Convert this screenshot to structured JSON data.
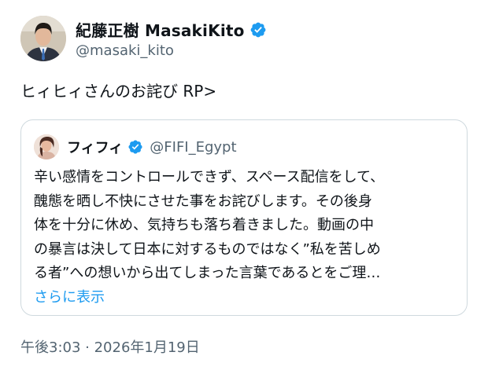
{
  "author": {
    "display_name": "紀藤正樹 MasakiKito",
    "handle": "@masaki_kito",
    "avatar_icon": "person-portrait-icon",
    "verified_icon": "verified-badge-icon"
  },
  "tweet": {
    "text": "ヒィヒィさんのお詫び RP>"
  },
  "quoted_tweet": {
    "display_name": "フィフィ",
    "handle": "@FIFI_Egypt",
    "avatar_icon": "person-portrait-icon",
    "verified_icon": "verified-badge-icon",
    "lines": [
      "辛い感情をコントロールできず、スペース配信をして、",
      "醜態を晒し不快にさせた事をお詫びします。その後身",
      "体を十分に休め、気持ちも落ち着きました。動画の中",
      "の暴言は決して日本に対するものではなく”私を苦しめ",
      "る者”への想いから出てしまった言葉であるとをご理…"
    ],
    "show_more_label": "さらに表示"
  },
  "timestamp": "午後3:03 · 2026年1月19日",
  "colors": {
    "accent": "#1d9bf0",
    "secondary_text": "#536471",
    "border": "#cfd9de"
  }
}
